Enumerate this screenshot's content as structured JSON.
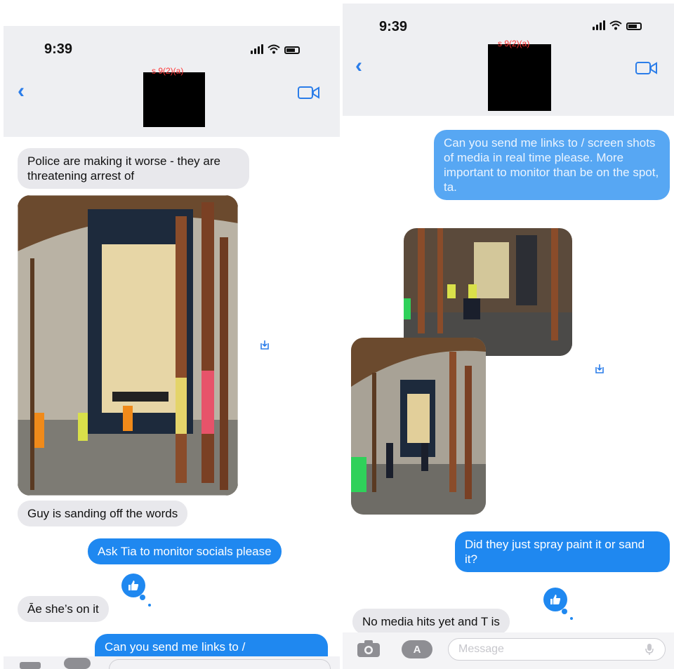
{
  "left_screen": {
    "status_bar": {
      "time": "9:39"
    },
    "header": {
      "redaction_label": "s 9(2)(a)"
    },
    "messages": {
      "incoming_1": "Police are making it worse - they are threatening arrest of",
      "incoming_2": "Guy is sanding off the words",
      "outgoing_1": "Ask Tia to monitor socials please",
      "incoming_3": "Āe she’s on it",
      "outgoing_2": "Can you send me links to /"
    },
    "photo_caption_icon": "download-icon",
    "tapback": "thumbs-up-icon"
  },
  "right_screen": {
    "status_bar": {
      "time": "9:39"
    },
    "header": {
      "redaction_label": "s 9(2)(a)"
    },
    "messages": {
      "outgoing_1": "Can you send me links to / screen shots of media in real time please. More important to monitor than be on the spot, ta.",
      "outgoing_2": "Did they just spray paint it or sand it?",
      "incoming_1": "No media hits yet and T is"
    },
    "composer": {
      "placeholder": "Message"
    },
    "tapback": "thumbs-up-icon"
  },
  "colors": {
    "imessage_blue": "#1f88f0",
    "incoming_gray": "#e8e8ec",
    "header_bg": "#eeeff2",
    "link_blue": "#2b7de9",
    "redaction": "#000000",
    "redaction_text": "#ff3333"
  }
}
